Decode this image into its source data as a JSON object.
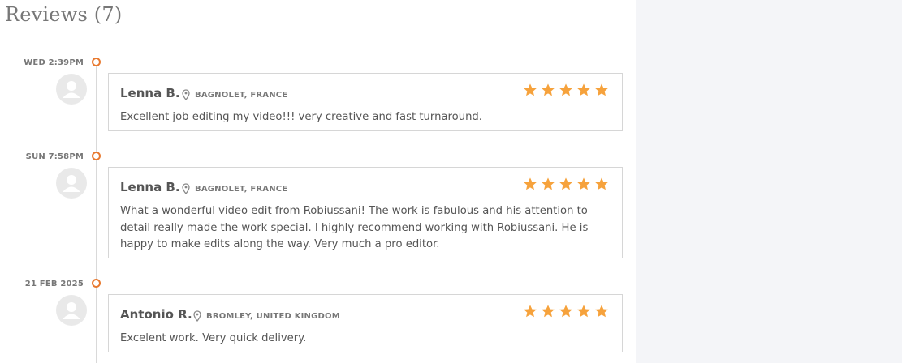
{
  "page": {
    "title": "Reviews (7)"
  },
  "colors": {
    "accent": "#e8792f",
    "star": "#f6a23c",
    "border": "#d6d6d6",
    "right_panel": "#f4f5f8"
  },
  "reviews": [
    {
      "time": "WED 2:39PM",
      "name": "Lenna B.",
      "location": "BAGNOLET, FRANCE",
      "rating": 5,
      "text": "Excellent job editing my video!!! very creative and fast turnaround."
    },
    {
      "time": "SUN 7:58PM",
      "name": "Lenna B.",
      "location": "BAGNOLET, FRANCE",
      "rating": 5,
      "text": "What a wonderful video edit from Robiussani! The work is fabulous and his attention to detail really made the work special. I highly recommend working with Robiussani. He is happy to make edits along the way. Very much a pro editor."
    },
    {
      "time": "21 FEB 2025",
      "name": "Antonio R.",
      "location": "BROMLEY, UNITED KINGDOM",
      "rating": 5,
      "text": "Excelent work. Very quick delivery."
    }
  ],
  "icons": {
    "avatar": "avatar-placeholder-icon",
    "location": "map-pin-icon",
    "rating": "star-icon"
  }
}
